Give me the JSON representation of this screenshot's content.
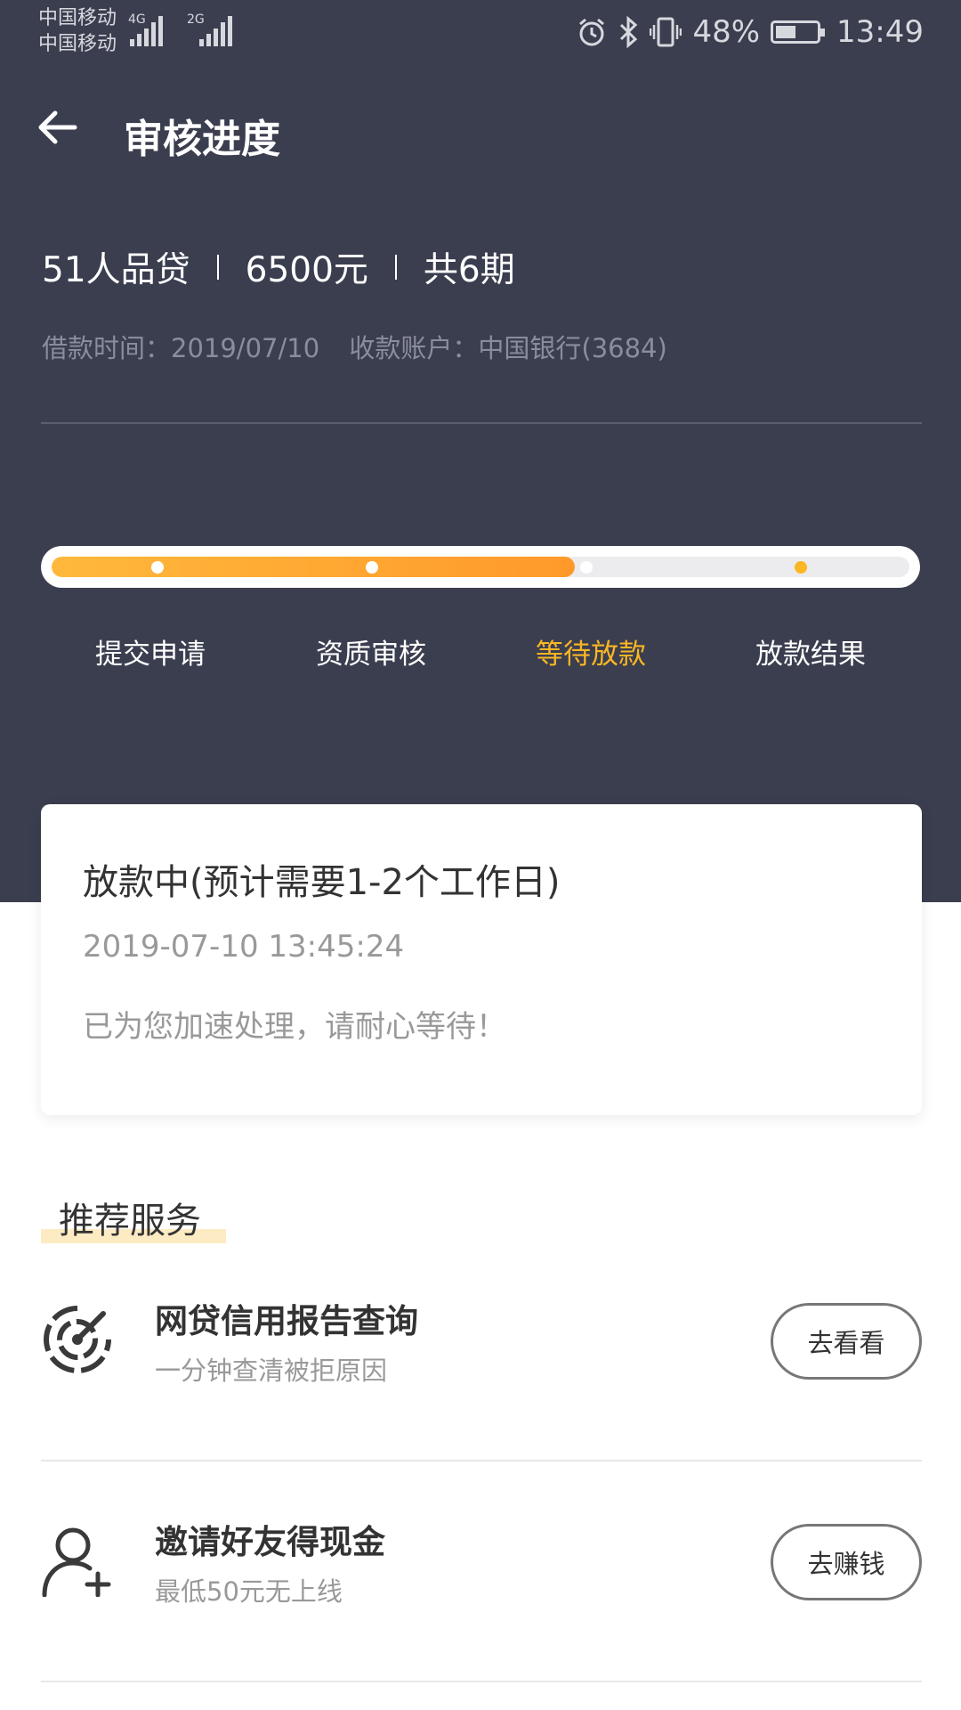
{
  "status_bar": {
    "carrier_1": "中国移动",
    "carrier_2": "中国移动",
    "network_1": "4G",
    "network_2": "2G",
    "battery_percent": "48%",
    "time": "13:49"
  },
  "header": {
    "title": "审核进度"
  },
  "loan": {
    "product": "51人品贷",
    "amount": "6500元",
    "periods": "共6期",
    "borrow_time": "借款时间：2019/07/10",
    "account": "收款账户：中国银行(3684)"
  },
  "progress": {
    "fill_fraction": 0.61,
    "steps": [
      {
        "label": "提交申请",
        "state": "done"
      },
      {
        "label": "资质审核",
        "state": "done"
      },
      {
        "label": "等待放款",
        "state": "active"
      },
      {
        "label": "放款结果",
        "state": "pending"
      }
    ]
  },
  "status_card": {
    "title": "放款中(预计需要1-2个工作日)",
    "time": "2019-07-10 13:45:24",
    "note": "已为您加速处理，请耐心等待！"
  },
  "recommend": {
    "title": "推荐服务",
    "services": [
      {
        "name": "网贷信用报告查询",
        "desc": "一分钟查清被拒原因",
        "button": "去看看",
        "icon": "credit-radar-icon"
      },
      {
        "name": "邀请好友得现金",
        "desc": "最低50元无上线",
        "button": "去赚钱",
        "icon": "add-user-icon"
      }
    ]
  },
  "colors": {
    "header_bg": "#3b3e4f",
    "accent": "#fbb624"
  }
}
